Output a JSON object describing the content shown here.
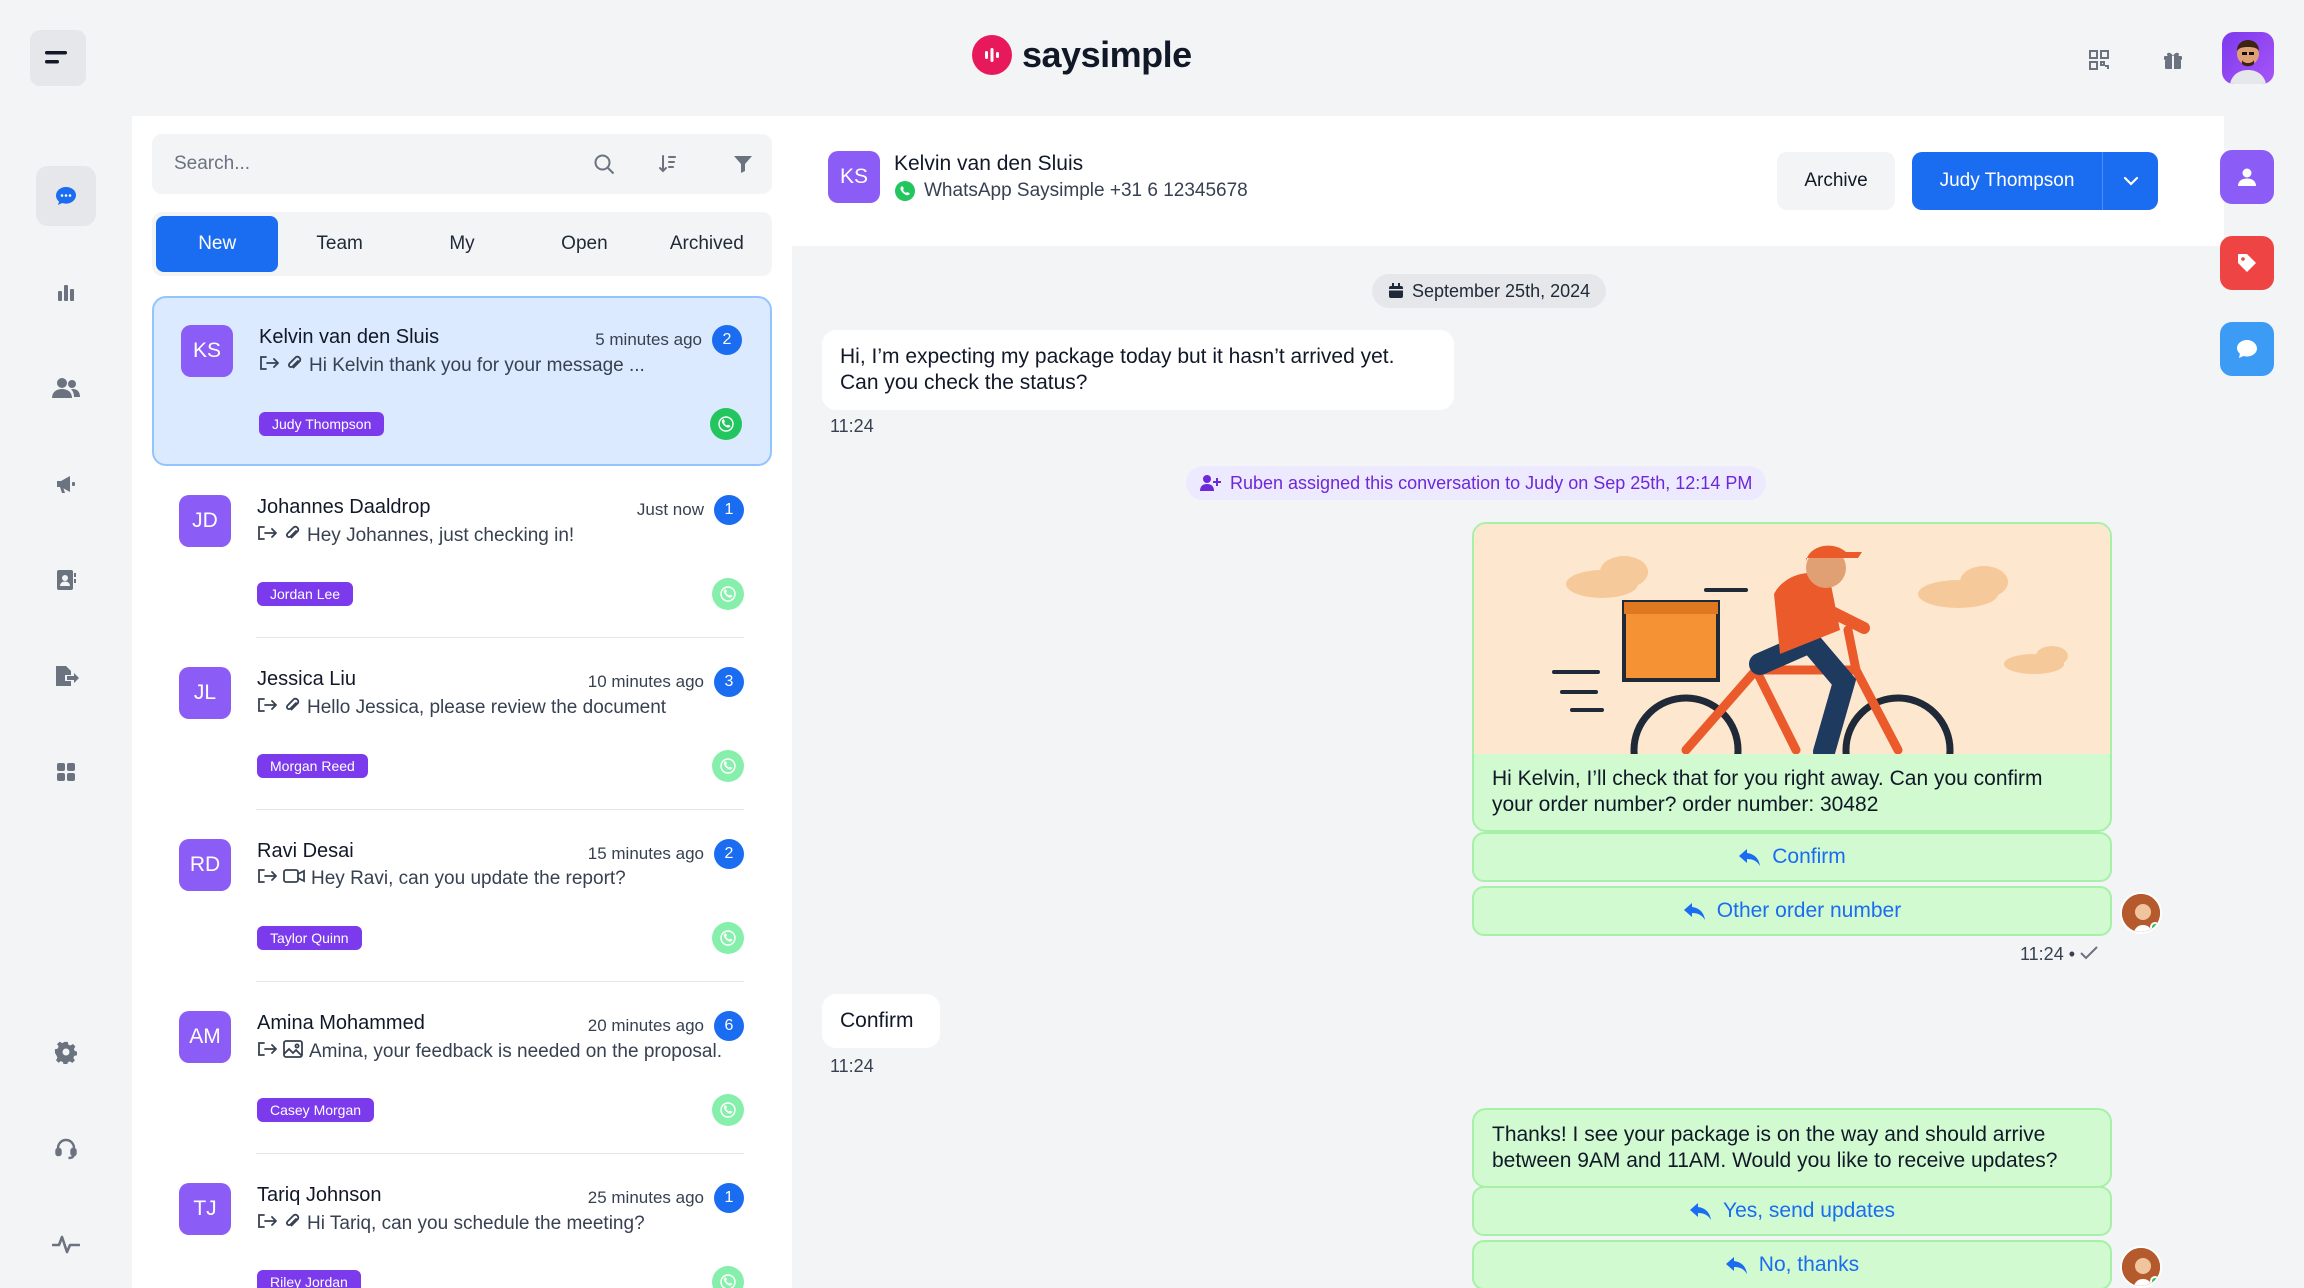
{
  "brand": {
    "name": "saysimple",
    "color": "#e8195a"
  },
  "top_icons": [
    "qr-code-icon",
    "gift-icon"
  ],
  "nav": [
    "chat-icon",
    "bar-chart-icon",
    "users-icon",
    "megaphone-icon",
    "contacts-icon",
    "export-icon",
    "apps-icon",
    "settings-icon",
    "headset-icon",
    "activity-icon"
  ],
  "search": {
    "placeholder": "Search..."
  },
  "tabs": [
    "New",
    "Team",
    "My",
    "Open",
    "Archived"
  ],
  "active_tab": "New",
  "conversations": [
    {
      "initials": "KS",
      "name": "Kelvin van den Sluis",
      "time": "5 minutes ago",
      "count": "2",
      "preview": "Hi Kelvin thank you for your message ...",
      "attachment": "paperclip-icon",
      "tag": "Judy Thompson"
    },
    {
      "initials": "JD",
      "name": "Johannes Daaldrop",
      "time": "Just now",
      "count": "1",
      "preview": "Hey Johannes, just checking in!",
      "attachment": "paperclip-icon",
      "tag": "Jordan Lee"
    },
    {
      "initials": "JL",
      "name": "Jessica Liu",
      "time": "10 minutes ago",
      "count": "3",
      "preview": "Hello Jessica, please review the document",
      "attachment": "paperclip-icon",
      "tag": "Morgan Reed"
    },
    {
      "initials": "RD",
      "name": "Ravi Desai",
      "time": "15 minutes ago",
      "count": "2",
      "preview": "Hey Ravi, can you update the report?",
      "attachment": "video-icon",
      "tag": "Taylor Quinn"
    },
    {
      "initials": "AM",
      "name": "Amina Mohammed",
      "time": "20 minutes ago",
      "count": "6",
      "preview": "Amina, your feedback is needed on the proposal.",
      "attachment": "image-icon",
      "tag": "Casey Morgan"
    },
    {
      "initials": "TJ",
      "name": "Tariq Johnson",
      "time": "25 minutes ago",
      "count": "1",
      "preview": "Hi Tariq, can you schedule the meeting?",
      "attachment": "paperclip-icon",
      "tag": "Riley Jordan"
    }
  ],
  "header": {
    "initials": "KS",
    "name": "Kelvin van den Sluis",
    "channel": "WhatsApp Saysimple +31 6 12345678",
    "archive_label": "Archive",
    "assignee": "Judy Thompson"
  },
  "messages": {
    "date": "September 25th, 2024",
    "in1_line1": "Hi, I’m expecting my package today but it hasn’t arrived yet.",
    "in1_line2": "Can you check the status?",
    "in1_time": "11:24",
    "system": "Ruben assigned this conversation to Judy on Sep 25th, 12:14 PM",
    "out1_line1": "Hi Kelvin, I’ll check that for you right away. Can you confirm",
    "out1_line2": "your order number? order number: 30482",
    "out1_btn1": "Confirm",
    "out1_btn2": "Other order number",
    "out1_time": "11:24",
    "in2": "Confirm",
    "in2_time": "11:24",
    "out2_line1": "Thanks! I see your package is on the way and should arrive",
    "out2_line2": "between 9AM and 11AM. Would you like to receive updates?",
    "out2_btn1": "Yes, send updates",
    "out2_btn2": "No, thanks"
  },
  "rail": [
    {
      "icon": "user-icon",
      "color": "#8b5cf6"
    },
    {
      "icon": "tag-icon",
      "color": "#ef4444"
    },
    {
      "icon": "chat-bubble-icon",
      "color": "#3b9bf5"
    }
  ]
}
